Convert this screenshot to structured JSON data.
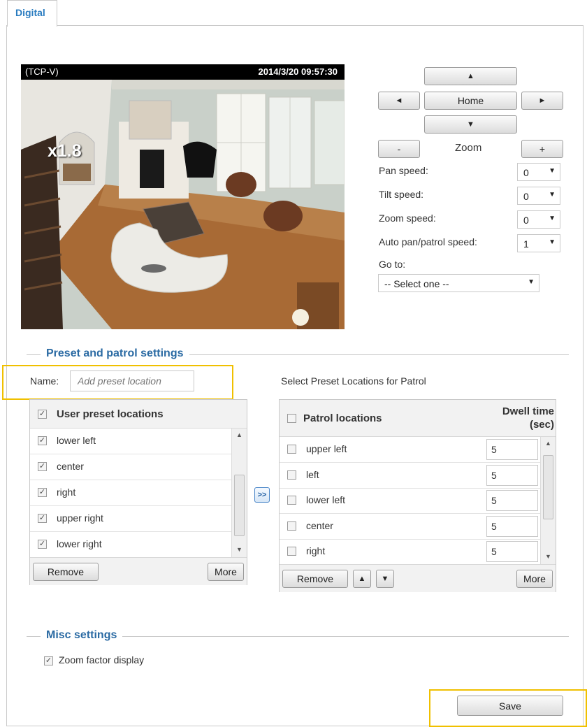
{
  "tab": {
    "label": "Digital"
  },
  "video": {
    "protocol": "(TCP-V)",
    "timestamp": "2014/3/20 09:57:30",
    "zoom_overlay": "x1.8"
  },
  "ptz": {
    "up_label": "▲",
    "left_label": "◄",
    "home_label": "Home",
    "right_label": "►",
    "down_label": "▼",
    "zoom_out_label": "-",
    "zoom_label": "Zoom",
    "zoom_in_label": "+",
    "pan_speed": {
      "label": "Pan speed:",
      "value": "0"
    },
    "tilt_speed": {
      "label": "Tilt speed:",
      "value": "0"
    },
    "zoom_speed": {
      "label": "Zoom speed:",
      "value": "0"
    },
    "auto_speed": {
      "label": "Auto pan/patrol speed:",
      "value": "1"
    },
    "goto": {
      "label": "Go to:",
      "value": "-- Select one --"
    }
  },
  "preset": {
    "section_title": "Preset and patrol settings",
    "name_label": "Name:",
    "name_placeholder": "Add preset location",
    "select_label": "Select Preset Locations for Patrol",
    "user_header": "User preset locations",
    "user_items": [
      "lower left",
      "center",
      "right",
      "upper right",
      "lower right"
    ],
    "transfer_label": ">>",
    "remove_label": "Remove",
    "more_label": "More",
    "patrol_header": "Patrol locations",
    "dwell_header_1": "Dwell time",
    "dwell_header_2": "(sec)",
    "patrol_items": [
      {
        "name": "upper left",
        "dwell": "5"
      },
      {
        "name": "left",
        "dwell": "5"
      },
      {
        "name": "lower left",
        "dwell": "5"
      },
      {
        "name": "center",
        "dwell": "5"
      },
      {
        "name": "right",
        "dwell": "5"
      }
    ],
    "patrol_remove_label": "Remove",
    "patrol_up_label": "▲",
    "patrol_down_label": "▼",
    "patrol_more_label": "More"
  },
  "misc": {
    "section_title": "Misc settings",
    "zoom_factor_label": "Zoom factor display",
    "check_mark": "✓"
  },
  "save_label": "Save",
  "colors": {
    "accent": "#2a6aa3",
    "highlight": "#f0c000"
  }
}
